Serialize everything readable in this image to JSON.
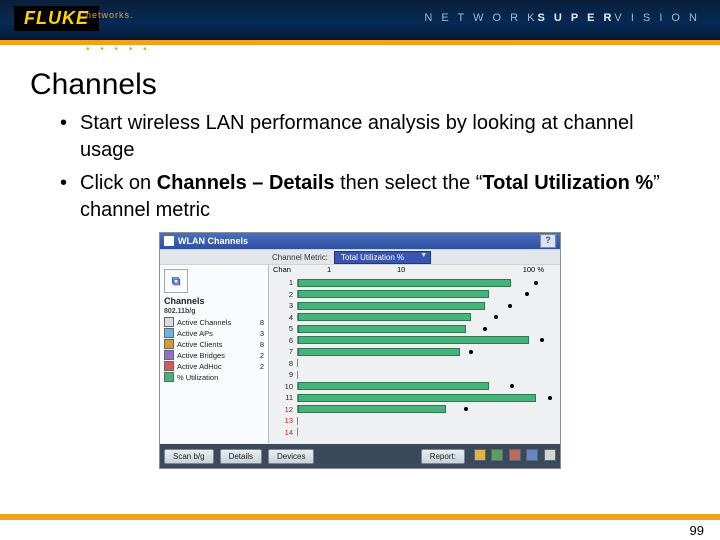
{
  "header": {
    "brand": "FLUKE",
    "brand_sub": "networks.",
    "right_label_a": "N E T W O R K",
    "right_label_b": "S U P E R",
    "right_label_c": "V I S I O N"
  },
  "title": "Channels",
  "bullets": [
    "Start wireless LAN performance analysis by looking at channel usage",
    "Click on <b>Channels – Details</b> then select the “<b>Total Utilization %</b>” channel metric"
  ],
  "shot": {
    "window_title": "WLAN Channels",
    "metric_label": "Channel Metric:",
    "metric_value": "Total Utilization %",
    "axis_label": "Chan",
    "axis_ticks": [
      "1",
      "10",
      "100 %"
    ],
    "side": {
      "header": "Channels",
      "subheader": "802.11b/g",
      "rows": [
        {
          "label": "Active Channels",
          "value": "8",
          "color": "#d7dde4"
        },
        {
          "label": "Active APs",
          "value": "3",
          "color": "#69b3e7"
        },
        {
          "label": "Active Clients",
          "value": "8",
          "color": "#d39a3a"
        },
        {
          "label": "Active Bridges",
          "value": "2",
          "color": "#8a73c9"
        },
        {
          "label": "Active AdHoc",
          "value": "2",
          "color": "#d15a5a"
        },
        {
          "label": "% Utilization",
          "value": "",
          "color": "#45b37a"
        }
      ]
    },
    "toolbar": {
      "left": "Scan b/g",
      "mid1": "Details",
      "mid2": "Devices",
      "right": "Report:"
    }
  },
  "chart_data": {
    "type": "bar",
    "title": "Total Utilization % by Channel",
    "xlabel": "Utilization %",
    "ylabel": "Channel",
    "x_scale": "log",
    "xlim": [
      1,
      100
    ],
    "categories": [
      "1",
      "2",
      "3",
      "4",
      "5",
      "6",
      "7",
      "8",
      "9",
      "10",
      "11",
      "12",
      "13",
      "14"
    ],
    "values": [
      45,
      30,
      28,
      22,
      20,
      62,
      18,
      0,
      0,
      30,
      70,
      14,
      0,
      0
    ],
    "peak_markers": [
      70,
      60,
      44,
      34,
      28,
      78,
      22,
      0,
      0,
      46,
      90,
      20,
      0,
      0
    ],
    "highlight_rows": [
      "12",
      "13",
      "14"
    ]
  },
  "page_number": "99"
}
